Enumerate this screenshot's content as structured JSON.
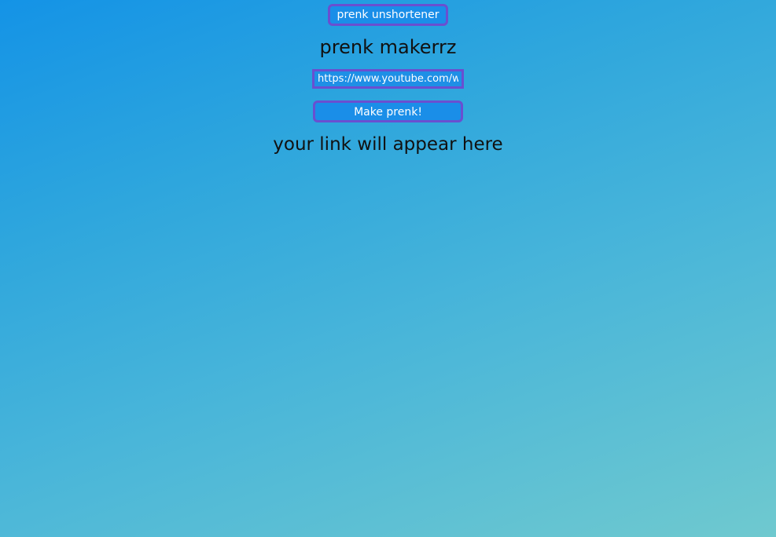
{
  "header": {
    "unshortener_label": "prenk unshortener"
  },
  "main": {
    "title": "prenk makerrz",
    "url_input": {
      "value": "https://www.youtube.com/wa",
      "placeholder": ""
    },
    "make_button_label": "Make prenk!",
    "result_text": "your link will appear here"
  },
  "colors": {
    "background_top": "#1493e6",
    "background_bottom": "#6fc9cf",
    "button_fill": "#1a8ee8",
    "button_border": "#6a4fd0",
    "text_dark": "#111111",
    "text_light": "#ffffff"
  }
}
